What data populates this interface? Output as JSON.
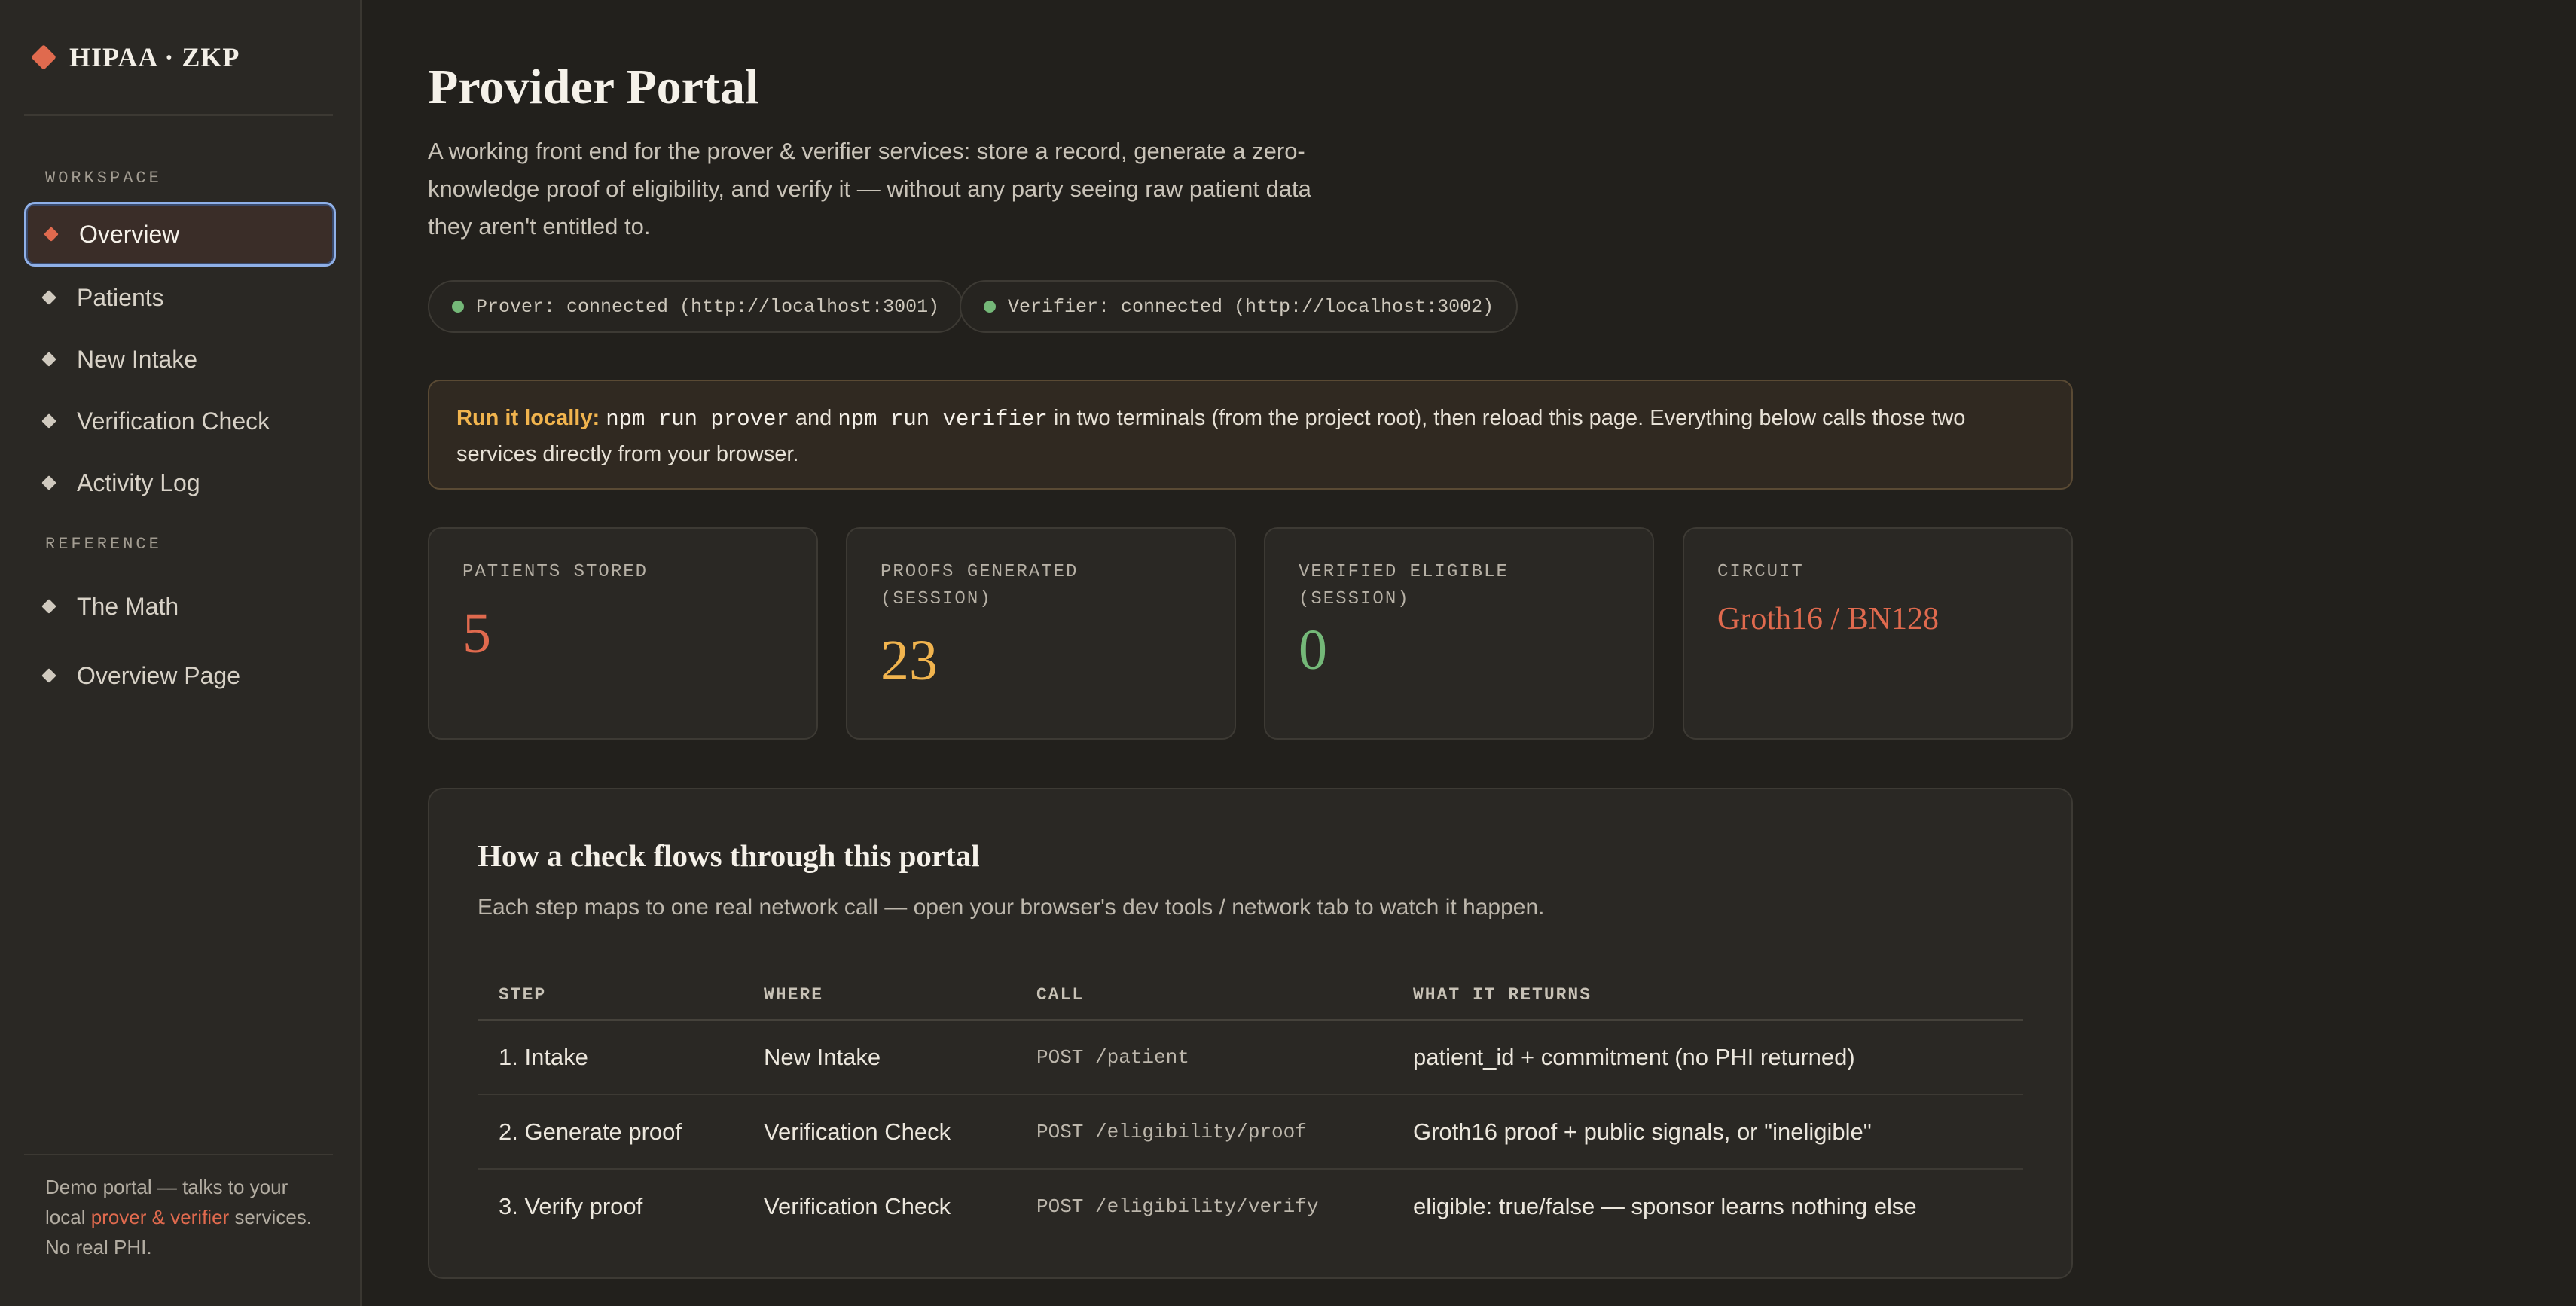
{
  "brand": {
    "name": "HIPAA · ZKP",
    "icon": "diamond-logo-icon",
    "accent": "#e06a4e"
  },
  "sidebar": {
    "sections": [
      {
        "label": "WORKSPACE"
      },
      {
        "label": "REFERENCE"
      }
    ],
    "items": [
      {
        "label": "Overview",
        "active": true
      },
      {
        "label": "Patients"
      },
      {
        "label": "New Intake"
      },
      {
        "label": "Verification Check"
      },
      {
        "label": "Activity Log"
      },
      {
        "label": "The Math"
      },
      {
        "label": "Overview Page"
      }
    ],
    "footer": {
      "line1": "Demo portal — talks to your",
      "local_prefix": "local ",
      "link_text": "prover & verifier",
      "local_suffix": " services.",
      "line3": "No real PHI."
    }
  },
  "main": {
    "title": "Provider Portal",
    "description": "A working front end for the prover & verifier services: store a record, generate a zero-knowledge proof of eligibility, and verify it — without any party seeing raw patient data they aren't entitled to.",
    "status": [
      {
        "text": "Prover: connected (http://localhost:3001)",
        "color": "#74b878"
      },
      {
        "text": "Verifier: connected (http://localhost:3002)",
        "color": "#74b878"
      }
    ],
    "notice": {
      "lead": "Run it locally:",
      "cmd1": "npm run prover",
      "and": " and ",
      "cmd2": "npm run verifier",
      "rest": " in two terminals (from the project root), then reload this page. Everything below calls those two services directly from your browser."
    },
    "stats": [
      {
        "label": "PATIENTS STORED",
        "value": "5",
        "color": "#e06a4e"
      },
      {
        "label": "PROOFS GENERATED (SESSION)",
        "value": "23",
        "color": "#f1b44e"
      },
      {
        "label": "VERIFIED ELIGIBLE (SESSION)",
        "value": "0",
        "color": "#74b878"
      },
      {
        "label": "CIRCUIT",
        "value": "Groth16 / BN128",
        "color": "#e06a4e"
      }
    ],
    "flow": {
      "title": "How a check flows through this portal",
      "subtitle": "Each step maps to one real network call — open your browser's dev tools / network tab to watch it happen.",
      "columns": [
        "STEP",
        "WHERE",
        "CALL",
        "WHAT IT RETURNS"
      ],
      "rows": [
        {
          "step": "1. Intake",
          "where": "New Intake",
          "call": "POST /patient",
          "returns": "patient_id + commitment (no PHI returned)"
        },
        {
          "step": "2. Generate proof",
          "where": "Verification Check",
          "call": "POST /eligibility/proof",
          "returns": "Groth16 proof + public signals, or \"ineligible\""
        },
        {
          "step": "3. Verify proof",
          "where": "Verification Check",
          "call": "POST /eligibility/verify",
          "returns": "eligible: true/false — sponsor learns nothing else"
        }
      ]
    }
  }
}
